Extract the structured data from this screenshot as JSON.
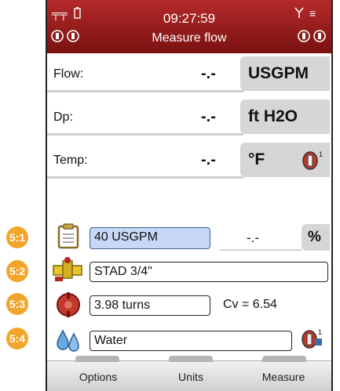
{
  "header": {
    "time": "09:27:59",
    "title": "Measure flow",
    "icons": [
      "signal-bars-icon",
      "battery-icon",
      "instrument-icon",
      "antenna-icon",
      "sensor-icon"
    ]
  },
  "measurements": [
    {
      "label": "Flow:",
      "value": "-.-",
      "unit": "USGPM"
    },
    {
      "label": "Dp:",
      "value": "-.-",
      "unit": "ft H2O"
    },
    {
      "label": "Temp:",
      "value": "-.-",
      "unit": "°F"
    }
  ],
  "controls": {
    "step1": {
      "badge": "5:1",
      "value": "40 USGPM",
      "readout": "-.-",
      "unit": "%"
    },
    "step2": {
      "badge": "5:2",
      "value": "STAD 3/4\""
    },
    "step3": {
      "badge": "5:3",
      "value": "3.98 turns",
      "cv": "Cv = 6.54"
    },
    "step4": {
      "badge": "5:4",
      "value": "Water"
    }
  },
  "softkeys": {
    "options": "Options",
    "units": "Units",
    "measure": "Measure"
  },
  "colors": {
    "header": "#9e1d1d",
    "badge": "#f3a42b",
    "field_blue": "#c6d8f3"
  }
}
